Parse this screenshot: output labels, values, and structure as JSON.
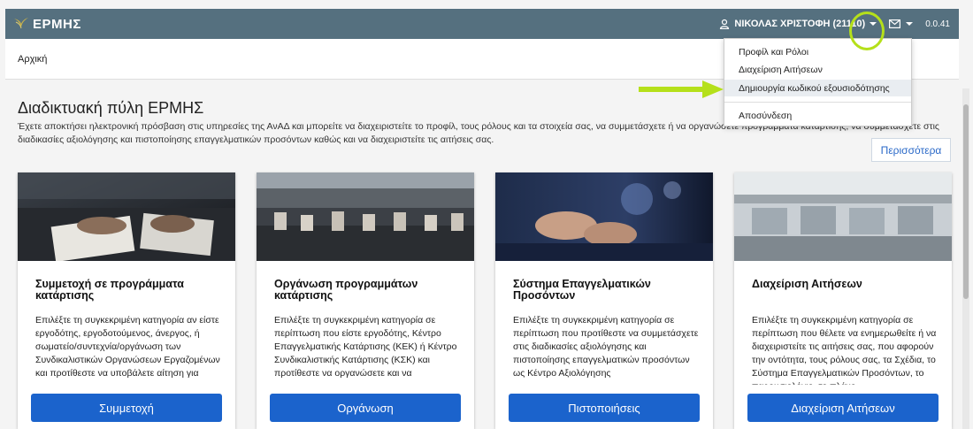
{
  "navbar": {
    "brand": "ΕΡΜΗΣ",
    "user_name": "ΝΙΚΟΛΑΣ ΧΡΙΣΤΟΦΗ (21110)",
    "version": "0.0.41"
  },
  "breadcrumb": {
    "home": "Αρχική"
  },
  "main": {
    "title": "Διαδικτυακή πύλη ΕΡΜΗΣ",
    "description": "Έχετε αποκτήσει ηλεκτρονική πρόσβαση στις υπηρεσίες της ΑνΑΔ και μπορείτε να διαχειριστείτε το προφίλ, τους ρόλους και τα στοιχεία σας, να συμμετάσχετε ή να οργανώσετε προγράμματα κατάρτισης, να συμμετάσχετε στις διαδικασίες αξιολόγησης και πιστοποίησης επαγγελματικών προσόντων καθώς και να διαχειριστείτε τις αιτήσεις σας.",
    "more_label": "Περισσότερα"
  },
  "cards": [
    {
      "title": "Συμμετοχή σε προγράμματα κατάρτισης",
      "text": "Επιλέξτε τη συγκεκριμένη κατηγορία αν είστε εργοδότης, εργοδοτούμενος, άνεργος, ή σωματείο/συντεχνία/οργάνωση των Συνδικαλιστικών Οργανώσεων Εργαζομένων και προτίθεστε να υποβάλετε αίτηση για",
      "button": "Συμμετοχή"
    },
    {
      "title": "Οργάνωση προγραμμάτων κατάρτισης",
      "text": "Επιλέξτε τη συγκεκριμένη κατηγορία σε περίπτωση που είστε εργοδότης, Κέντρο Επαγγελματικής Κατάρτισης (ΚΕΚ) ή Κέντρο Συνδικαλιστικής Κατάρτισης (ΚΣΚ) και προτίθεστε να οργανώσετε και να",
      "button": "Οργάνωση"
    },
    {
      "title": "Σύστημα Επαγγελματικών Προσόντων",
      "text": "Επιλέξτε τη συγκεκριμένη κατηγορία σε περίπτωση που προτίθεστε να συμμετάσχετε στις διαδικασίες αξιολόγησης και πιστοποίησης επαγγελματικών προσόντων ως Κέντρο Αξιολόγησης",
      "button": "Πιστοποιήσεις"
    },
    {
      "title": "Διαχείριση Αιτήσεων",
      "text": "Επιλέξτε τη συγκεκριμένη κατηγορία σε περίπτωση που θέλετε να ενημερωθείτε ή να διαχειριστείτε τις αιτήσεις σας, που αφορούν την οντότητα, τους ρόλους σας, τα Σχέδια, το Σύστημα Επαγγελματικών Προσόντων, το παρουσιολόγιο, το πλάνο",
      "button": "Διαχείριση Αιτήσεων"
    }
  ],
  "dropdown": {
    "items": [
      "Προφίλ και Ρόλοι",
      "Διαχείριση Αιτήσεων",
      "Δημιουργία κωδικού εξουσιοδότησης",
      "Αποσύνδεση"
    ],
    "active_index": 2
  },
  "colors": {
    "navbar": "#55707f",
    "primary_button": "#1b63cc",
    "annotation": "#b5e01a"
  },
  "icons": [
    "hermes-logo-icon",
    "user-icon",
    "mail-icon",
    "caret-down-icon"
  ]
}
